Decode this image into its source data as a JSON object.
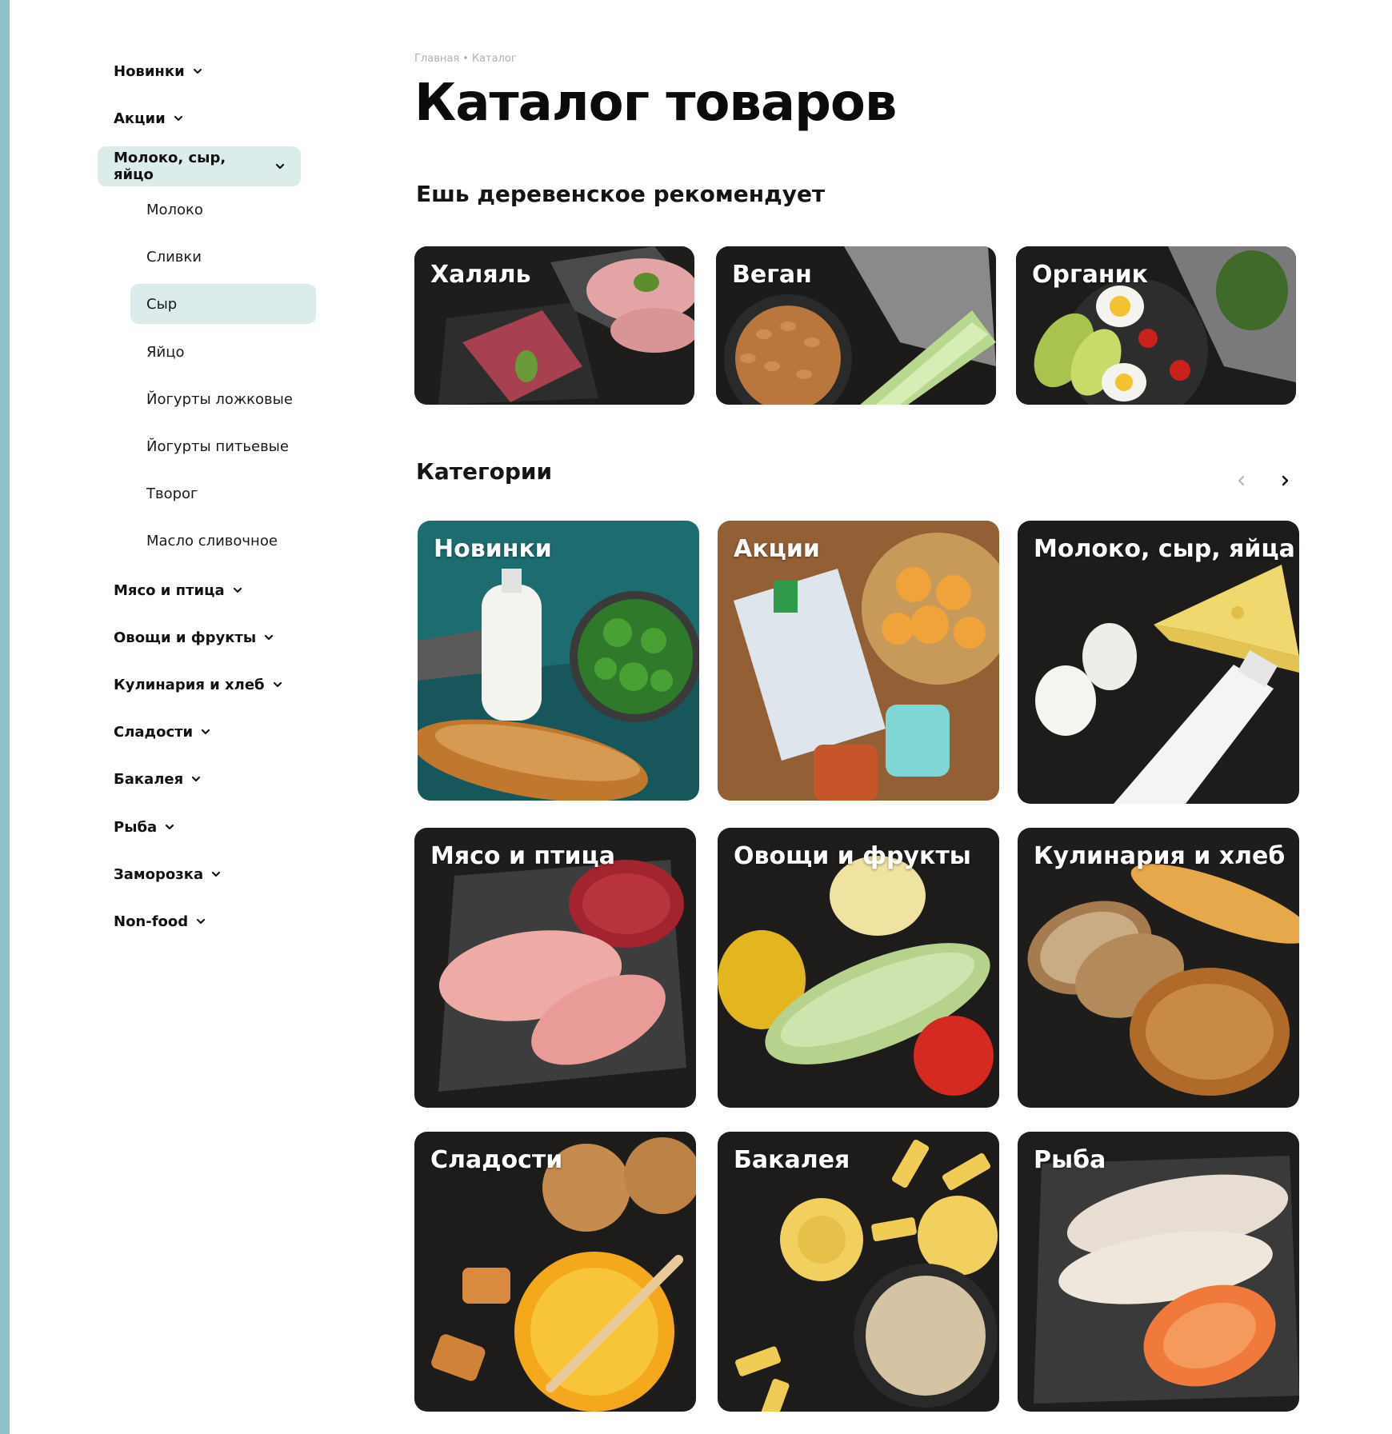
{
  "breadcrumb": {
    "home": "Главная",
    "separator": "•",
    "current": "Каталог"
  },
  "page_title": "Каталог товаров",
  "recommend_title": "Ешь деревенское рекомендует",
  "categories_title": "Категории",
  "sidebar": {
    "items": [
      {
        "label": "Новинки"
      },
      {
        "label": "Акции"
      },
      {
        "label": "Молоко, сыр, яйцо"
      },
      {
        "label": "Мясо и птица"
      },
      {
        "label": "Овощи и фрукты"
      },
      {
        "label": "Кулинария и хлеб"
      },
      {
        "label": "Сладости"
      },
      {
        "label": "Бакалея"
      },
      {
        "label": "Рыба"
      },
      {
        "label": "Заморозка"
      },
      {
        "label": "Non-food"
      }
    ],
    "subitems": [
      {
        "label": "Молоко"
      },
      {
        "label": "Сливки"
      },
      {
        "label": "Сыр"
      },
      {
        "label": "Яйцо"
      },
      {
        "label": "Йогурты ложковые"
      },
      {
        "label": "Йогурты питьевые"
      },
      {
        "label": "Творог"
      },
      {
        "label": "Масло сливочное"
      }
    ]
  },
  "recommend": [
    {
      "label": "Халяль"
    },
    {
      "label": "Веган"
    },
    {
      "label": "Органик"
    }
  ],
  "categories": [
    {
      "label": "Новинки"
    },
    {
      "label": "Акции"
    },
    {
      "label": "Молоко, сыр, яйца"
    },
    {
      "label": "Мясо и птица"
    },
    {
      "label": "Овощи и фрукты"
    },
    {
      "label": "Кулинария и хлеб"
    },
    {
      "label": "Сладости"
    },
    {
      "label": "Бакалея"
    },
    {
      "label": "Рыба"
    }
  ],
  "colors": {
    "accent": "#dbeceb",
    "stripe": "#8dc3c6",
    "card_dark": "#1f1f1f",
    "card_teal": "#1d6d70",
    "card_wood": "#8a5a32"
  }
}
